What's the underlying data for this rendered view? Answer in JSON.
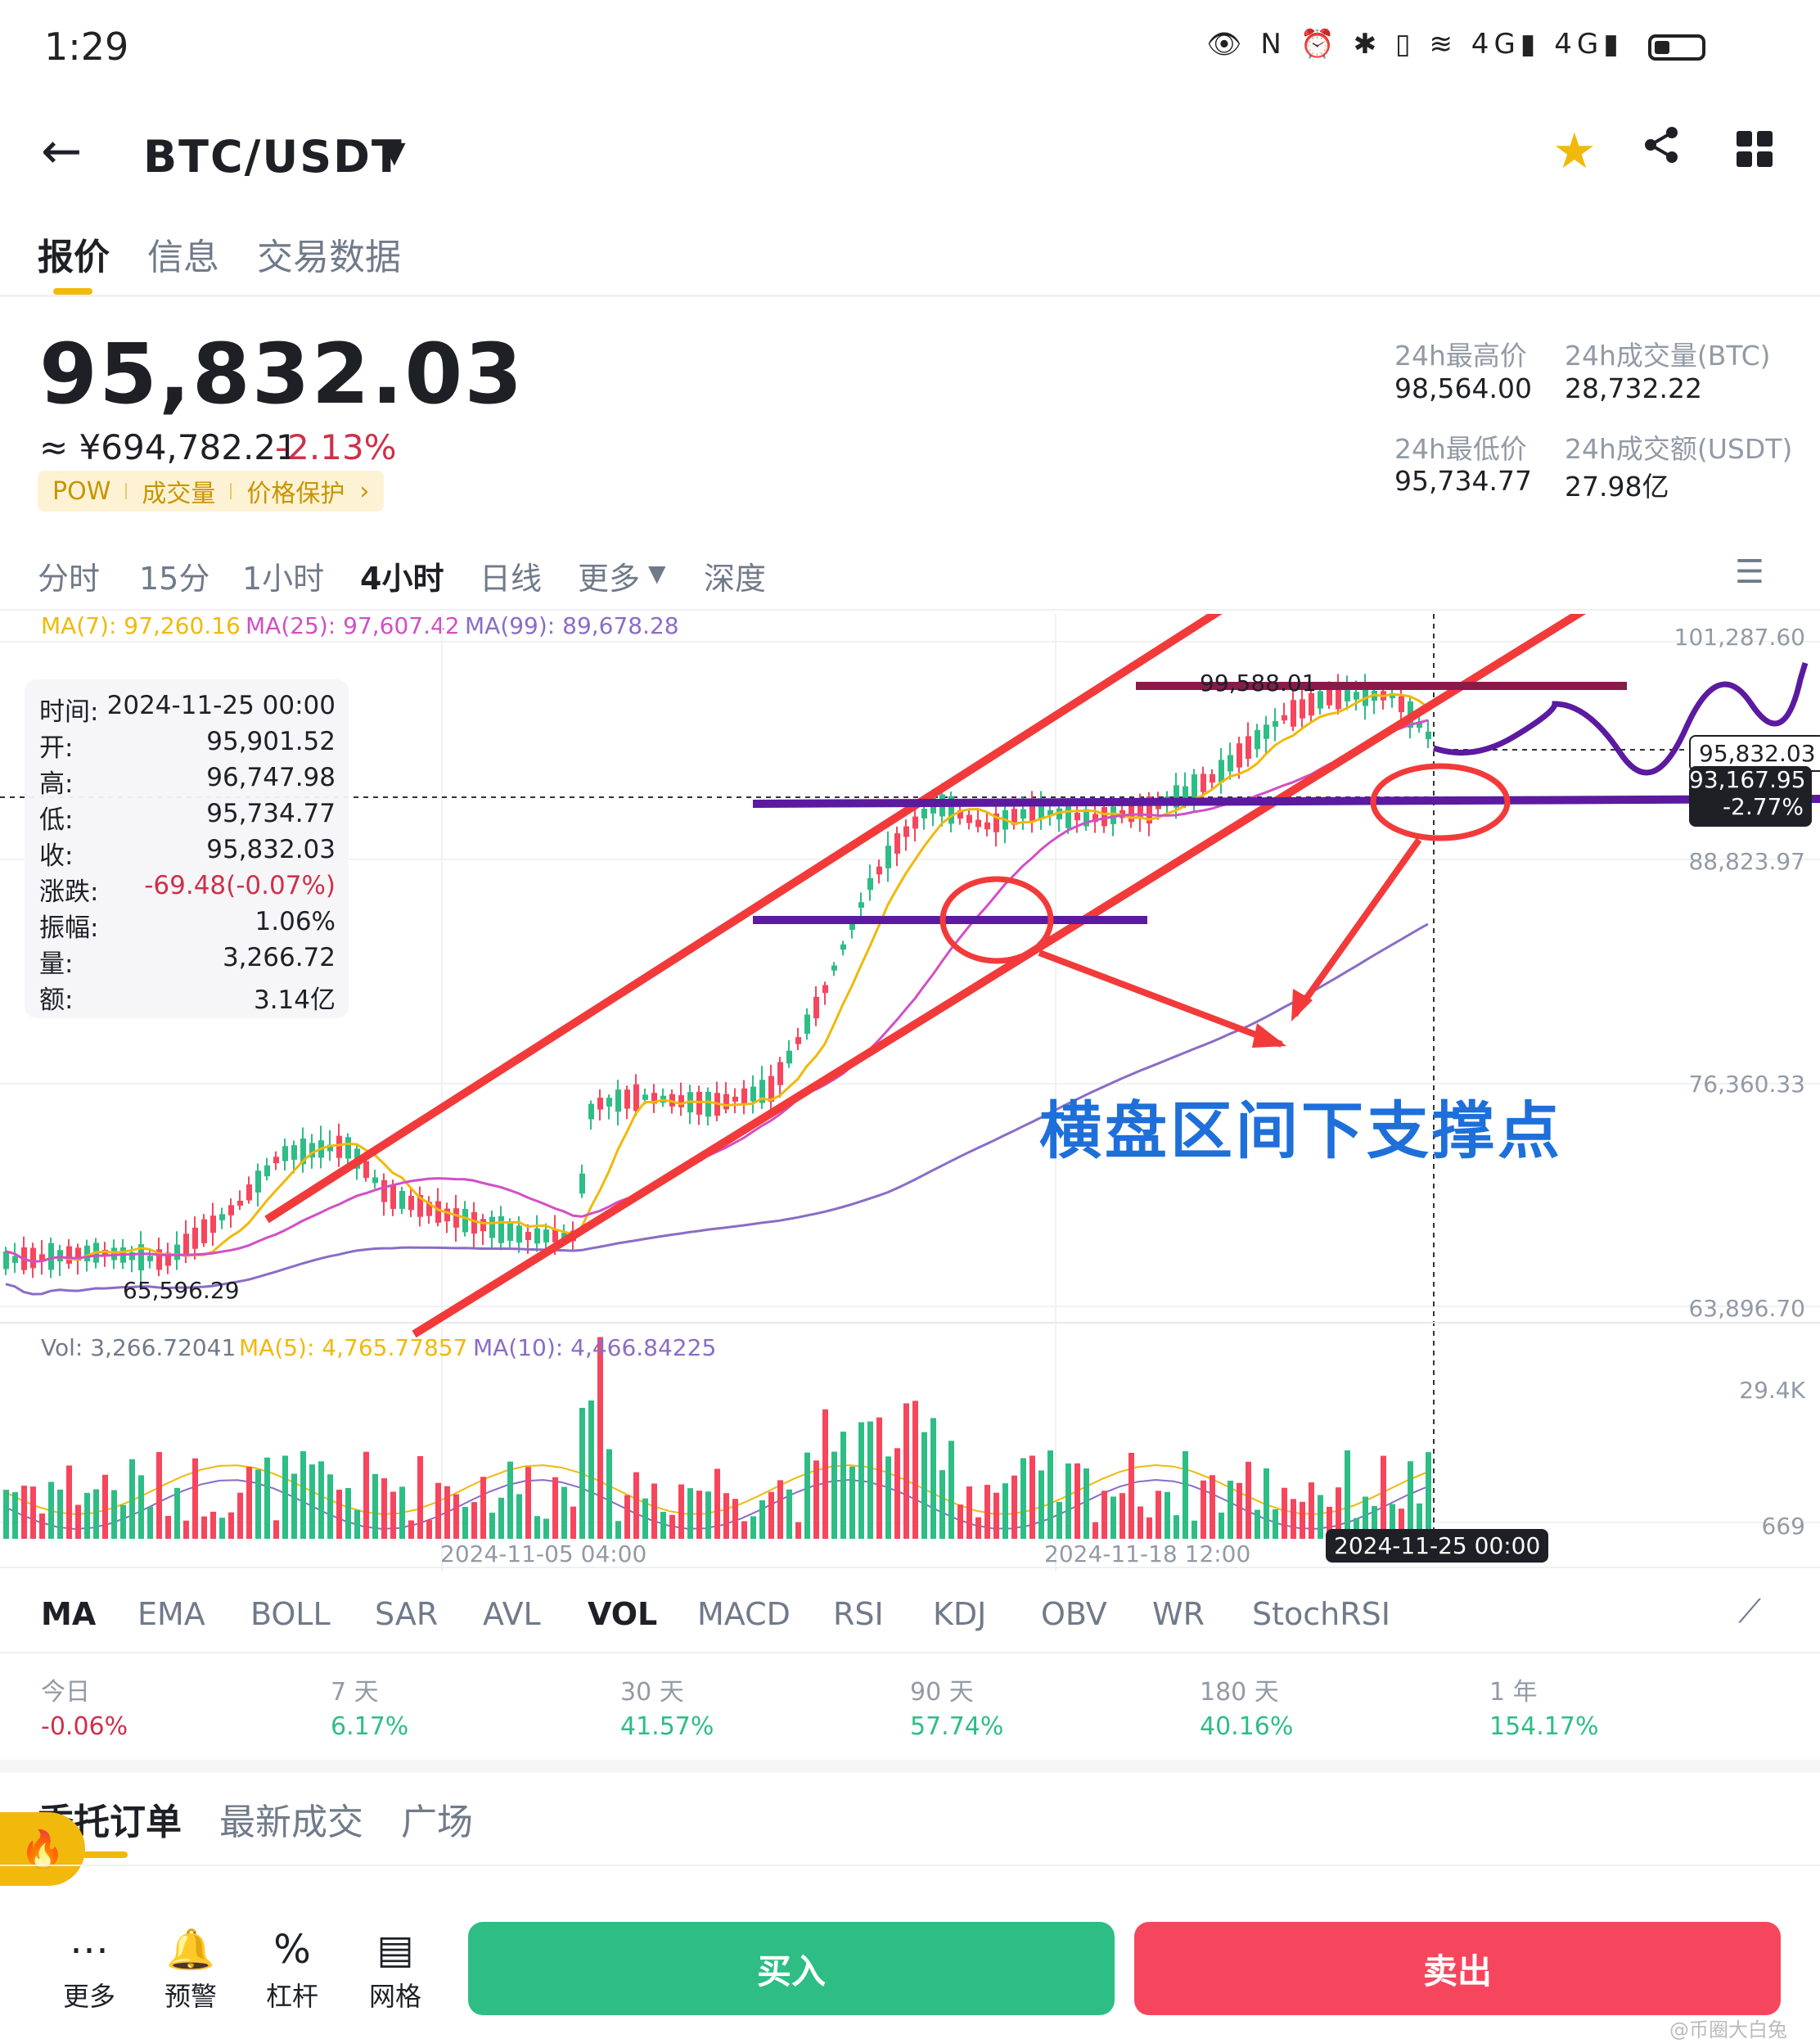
{
  "status": {
    "time": "1:29",
    "icons": "👁 N ⏰ ✱ ▯ ≋ 4G▮ 4G▮"
  },
  "header": {
    "pair": "BTC/USDT"
  },
  "tabs": [
    "报价",
    "信息",
    "交易数据"
  ],
  "ticker": {
    "last_price": "95,832.03",
    "cny": "≈ ¥694,782.21",
    "change_pct": "-2.13%",
    "tags": [
      "POW",
      "成交量",
      "价格保护"
    ],
    "high_label": "24h最高价",
    "high": "98,564.00",
    "vol_btc_label": "24h成交量(BTC)",
    "vol_btc": "28,732.22",
    "low_label": "24h最低价",
    "low": "95,734.77",
    "vol_usdt_label": "24h成交额(USDT)",
    "vol_usdt": "27.98亿"
  },
  "timeframes": [
    "分时",
    "15分",
    "1小时",
    "4小时",
    "日线",
    "更多",
    "深度"
  ],
  "active_timeframe": 3,
  "ma_legend": {
    "ma7": "MA(7): 97,260.16",
    "ma25": "MA(25): 97,607.42",
    "ma99": "MA(99): 89,678.28"
  },
  "colors": {
    "up": "#2ebd85",
    "down": "#f6465d",
    "ma7": "#f0b90b",
    "ma25": "#d24fc4",
    "ma99": "#8a6cc6",
    "accent": "#f0b90b",
    "annotation_red": "#f23a3a",
    "annotation_purple": "#5b1aa0",
    "annotation_maroon": "#8a1a4a",
    "annotation_text": "#1e6fd9"
  },
  "price_axis": [
    "101,287.60",
    "88,823.97",
    "76,360.33",
    "63,896.70"
  ],
  "chart_labels": {
    "high_mark": "99,588.01",
    "low_mark": "65,596.29",
    "last_price_tag": "95,832.03",
    "cross_price": "93,167.95",
    "cross_pct": "-2.77%"
  },
  "tooltip": [
    {
      "k": "时间:",
      "v": "2024-11-25 00:00"
    },
    {
      "k": "开:",
      "v": "95,901.52"
    },
    {
      "k": "高:",
      "v": "96,747.98"
    },
    {
      "k": "低:",
      "v": "95,734.77"
    },
    {
      "k": "收:",
      "v": "95,832.03"
    },
    {
      "k": "涨跌:",
      "v": "-69.48(-0.07%)"
    },
    {
      "k": "振幅:",
      "v": "1.06%"
    },
    {
      "k": "量:",
      "v": "3,266.72"
    },
    {
      "k": "额:",
      "v": "3.14亿"
    }
  ],
  "annotation": "横盘区间下支撑点",
  "volume_legend": {
    "vol": "Vol: 3,266.72041",
    "ma5": "MA(5): 4,765.77857",
    "ma10": "MA(10): 4,466.84225"
  },
  "volume_axis": [
    "29.4K",
    "669"
  ],
  "time_axis": [
    "2024-11-05 04:00",
    "2024-11-18 12:00"
  ],
  "cursor_time": "2024-11-25 00:00",
  "indicators": [
    "MA",
    "EMA",
    "BOLL",
    "SAR",
    "AVL",
    "VOL",
    "MACD",
    "RSI",
    "KDJ",
    "OBV",
    "WR",
    "StochRSI"
  ],
  "performance": [
    {
      "label": "今日",
      "value": "-0.06%",
      "neg": true
    },
    {
      "label": "7 天",
      "value": "6.17%",
      "neg": false
    },
    {
      "label": "30 天",
      "value": "41.57%",
      "neg": false
    },
    {
      "label": "90 天",
      "value": "57.74%",
      "neg": false
    },
    {
      "label": "180 天",
      "value": "40.16%",
      "neg": false
    },
    {
      "label": "1 年",
      "value": "154.17%",
      "neg": false
    }
  ],
  "order_tabs": [
    "委托订单",
    "最新成交",
    "广场"
  ],
  "bottom_nav": [
    {
      "icon": "more-icon",
      "label": "更多"
    },
    {
      "icon": "bell-icon",
      "label": "预警"
    },
    {
      "icon": "leverage-icon",
      "label": "杠杆"
    },
    {
      "icon": "grid-icon",
      "label": "网格"
    }
  ],
  "actions": {
    "buy": "买入",
    "sell": "卖出"
  },
  "watermark": "@币圈大白兔"
}
